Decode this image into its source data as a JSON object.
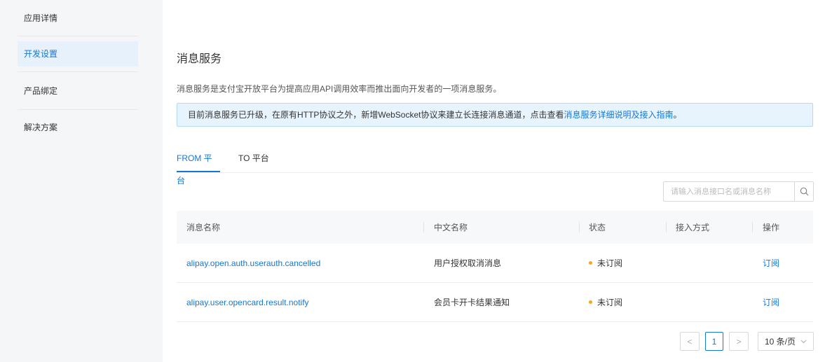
{
  "sidebar": {
    "items": [
      {
        "label": "应用详情",
        "active": false
      },
      {
        "label": "开发设置",
        "active": true
      },
      {
        "label": "产品绑定",
        "active": false
      },
      {
        "label": "解决方案",
        "active": false
      }
    ]
  },
  "main": {
    "title": "消息服务",
    "description": "消息服务是支付宝开放平台为提高应用API调用效率而推出面向开发者的一项消息服务。",
    "notice": {
      "text": "目前消息服务已升级，在原有HTTP协议之外，新增WebSocket协议来建立长连接消息通道，点击查看",
      "link": "消息服务详细说明及接入指南",
      "suffix": "。"
    },
    "tabs": [
      {
        "label": "FROM 平台",
        "active": true
      },
      {
        "label": "TO 平台",
        "active": false
      }
    ],
    "search": {
      "placeholder": "请输入消息接口名或消息名称",
      "icon": "search-icon"
    },
    "table": {
      "headers": [
        "消息名称",
        "中文名称",
        "状态",
        "接入方式",
        "操作"
      ],
      "rows": [
        {
          "name": "alipay.open.auth.userauth.cancelled",
          "cn_name": "用户授权取消消息",
          "status": "未订阅",
          "access": "",
          "action": "订阅"
        },
        {
          "name": "alipay.user.opencard.result.notify",
          "cn_name": "会员卡开卡结果通知",
          "status": "未订阅",
          "access": "",
          "action": "订阅"
        }
      ]
    },
    "pagination": {
      "prev": "<",
      "current": "1",
      "next": ">",
      "page_size": "10 条/页"
    }
  },
  "colors": {
    "accent": "#1677d2",
    "status_dot": "#f5a623",
    "sidebar_bg": "#f5f6f8"
  }
}
